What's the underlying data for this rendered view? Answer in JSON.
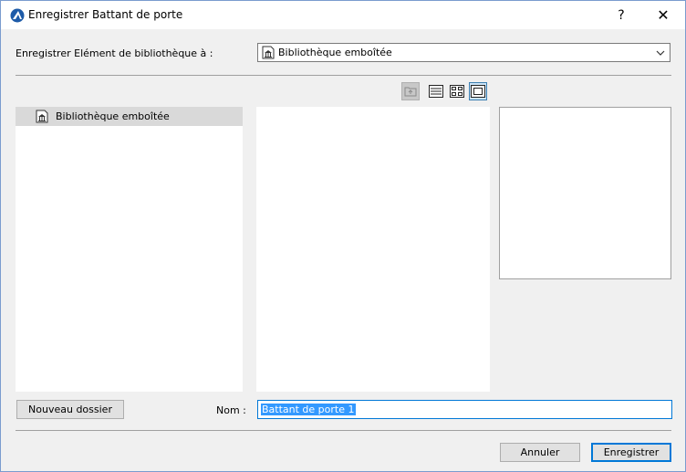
{
  "window": {
    "title": "Enregistrer Battant de porte",
    "help_label": "?",
    "close_label": "✕"
  },
  "save_to": {
    "label": "Enregistrer Elément de bibliothèque à :",
    "selected": "Bibliothèque emboîtée"
  },
  "tree": {
    "items": [
      {
        "label": "Bibliothèque emboîtée",
        "selected": true
      }
    ]
  },
  "view_modes": {
    "active": "large-preview",
    "disabled": [
      "up-folder"
    ]
  },
  "new_folder_label": "Nouveau dossier",
  "name": {
    "label": "Nom :",
    "value": "Battant de porte 1"
  },
  "footer": {
    "cancel_label": "Annuler",
    "save_label": "Enregistrer"
  },
  "colors": {
    "accent": "#0078d7",
    "selection": "#3399ff"
  }
}
